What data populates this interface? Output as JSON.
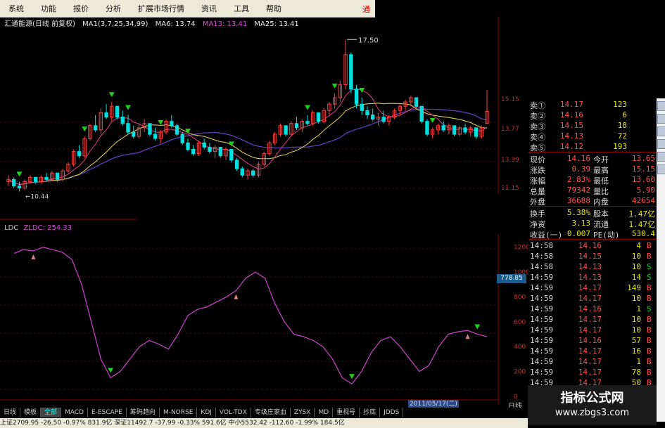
{
  "menu": {
    "items": [
      "系统",
      "功能",
      "报价",
      "分析",
      "扩展市场行情",
      "资讯",
      "工具",
      "帮助"
    ],
    "corner_label": "通"
  },
  "title": {
    "stock": "汇通能源(日线 前复权)",
    "ma1": "MA1(3,7,25,34,99)",
    "ma6": "MA6: 13.74",
    "ma13": "MA13: 13.41",
    "ma25": "MA25: 13.41"
  },
  "annotations": {
    "high": "17.50",
    "low": "10.44"
  },
  "left_axis_ticks": [
    "1200",
    "1000",
    "800",
    "600",
    "400",
    "200",
    "0"
  ],
  "ldc": {
    "label": "LDC",
    "value": "ZLDC: 254.33"
  },
  "price_tag": "778.85",
  "right_axis_main": [
    "15.15",
    "13.77",
    "13.39",
    "11.15"
  ],
  "quote_panel": {
    "asks": [
      {
        "label": "卖①",
        "price": "14.17",
        "vol": "123"
      },
      {
        "label": "卖②",
        "price": "14.16",
        "vol": "6"
      },
      {
        "label": "卖③",
        "price": "14.15",
        "vol": "18"
      },
      {
        "label": "卖④",
        "price": "14.13",
        "vol": "72"
      },
      {
        "label": "卖⑤",
        "price": "14.12",
        "vol": "193"
      }
    ],
    "stats": [
      {
        "l1": "现价",
        "v1": "14.16",
        "l2": "今开",
        "v2": "13.65"
      },
      {
        "l1": "涨跌",
        "v1": "0.39",
        "l2": "最高",
        "v2": "15.15"
      },
      {
        "l1": "涨幅",
        "v1": "2.83%",
        "l2": "最低",
        "v2": "13.60"
      },
      {
        "l1": "总量",
        "v1": "79342",
        "l2": "量比",
        "v2": "5.90"
      },
      {
        "l1": "外盘",
        "v1": "36688",
        "l2": "内盘",
        "v2": "42654"
      }
    ],
    "stats2": [
      {
        "l1": "换手",
        "v1": "5.38%",
        "l2": "股本",
        "v2": "1.47亿"
      },
      {
        "l1": "净资",
        "v1": "3.13",
        "l2": "流通",
        "v2": "1.47亿"
      },
      {
        "l1": "收益(一)",
        "v1": "0.007",
        "l2": "PE(动)",
        "v2": "530.4"
      }
    ],
    "ticks": [
      {
        "t": "14:58",
        "p": "14.16",
        "v": "4",
        "s": "B"
      },
      {
        "t": "14:58",
        "p": "14.15",
        "v": "10",
        "s": "B"
      },
      {
        "t": "14:58",
        "p": "14.13",
        "v": "10",
        "s": "S"
      },
      {
        "t": "14:59",
        "p": "14.13",
        "v": "14",
        "s": "S"
      },
      {
        "t": "14:59",
        "p": "14.17",
        "v": "149",
        "s": "B"
      },
      {
        "t": "14:59",
        "p": "14.17",
        "v": "10",
        "s": "B"
      },
      {
        "t": "14:59",
        "p": "14.16",
        "v": "1",
        "s": "S"
      },
      {
        "t": "14:59",
        "p": "14.17",
        "v": "10",
        "s": "B"
      },
      {
        "t": "14:59",
        "p": "14.17",
        "v": "10",
        "s": "B"
      },
      {
        "t": "14:59",
        "p": "14.16",
        "v": "57",
        "s": "B"
      },
      {
        "t": "14:59",
        "p": "14.17",
        "v": "16",
        "s": "B"
      },
      {
        "t": "14:59",
        "p": "14.17",
        "v": "1",
        "s": "B"
      },
      {
        "t": "14:59",
        "p": "14.17",
        "v": "78",
        "s": "B"
      },
      {
        "t": "14:59",
        "p": "14.17",
        "v": "50",
        "s": "B"
      }
    ]
  },
  "tabs": [
    "日线",
    "模板",
    "全部",
    "MACD",
    "E-ESCAPE",
    "筹码趋向",
    "M-NORSE",
    "KDJ",
    "VOL-TDX",
    "专级庄家血",
    "ZYSX",
    "MD",
    "重视号",
    "抄底",
    "JDDS"
  ],
  "active_tab_index": 2,
  "date_box": "2011/05/17(二)",
  "daily_label": "日线",
  "status_text": "上证2709.95 -26.50 -0.97% 831.9亿 深证11492.7 -37.99 -0.33% 591.6亿 中小5532.42 -112.60 -1.99% 184.5亿",
  "watermark": {
    "line1": "指标公式网",
    "line2": "www.zbgs3.com"
  },
  "colors": {
    "up": "#ff3c3c",
    "down": "#00e0e0",
    "ldc": "#c040c0",
    "ma_yellow": "#d8c850",
    "ma_purple": "#6040c0",
    "ma_pink": "#e04080"
  },
  "chart_data": {
    "type": "candlestick",
    "candles": [
      [
        10.9,
        11.2,
        10.7,
        11.0
      ],
      [
        11.0,
        11.1,
        10.6,
        10.7
      ],
      [
        10.7,
        10.9,
        10.44,
        10.6
      ],
      [
        10.6,
        11.0,
        10.5,
        10.9
      ],
      [
        10.9,
        11.2,
        10.8,
        11.1
      ],
      [
        11.1,
        11.0,
        10.8,
        10.9
      ],
      [
        10.9,
        11.2,
        10.8,
        11.1
      ],
      [
        11.1,
        11.3,
        10.9,
        11.0
      ],
      [
        11.0,
        11.4,
        10.9,
        11.3
      ],
      [
        11.3,
        11.2,
        10.9,
        11.0
      ],
      [
        11.0,
        11.5,
        10.9,
        11.4
      ],
      [
        11.4,
        11.8,
        11.3,
        11.7
      ],
      [
        11.7,
        12.4,
        11.6,
        12.3
      ],
      [
        12.3,
        12.6,
        12.0,
        12.1
      ],
      [
        12.1,
        13.0,
        12.0,
        12.9
      ],
      [
        12.9,
        13.6,
        12.8,
        13.5
      ],
      [
        13.5,
        14.0,
        13.2,
        13.3
      ],
      [
        13.3,
        14.3,
        13.1,
        14.1
      ],
      [
        14.1,
        14.5,
        13.8,
        13.9
      ],
      [
        13.9,
        14.6,
        13.7,
        14.4
      ],
      [
        14.4,
        14.3,
        13.8,
        13.9
      ],
      [
        13.9,
        14.2,
        13.5,
        13.6
      ],
      [
        13.6,
        14.0,
        13.1,
        13.2
      ],
      [
        13.2,
        13.5,
        12.9,
        13.0
      ],
      [
        13.0,
        13.6,
        12.9,
        13.4
      ],
      [
        13.4,
        13.8,
        13.2,
        13.6
      ],
      [
        13.6,
        13.5,
        13.0,
        13.1
      ],
      [
        13.1,
        13.4,
        12.8,
        12.9
      ],
      [
        12.9,
        13.3,
        12.7,
        13.2
      ],
      [
        13.2,
        13.8,
        13.1,
        13.7
      ],
      [
        13.7,
        14.0,
        13.4,
        13.5
      ],
      [
        13.5,
        13.6,
        13.0,
        13.1
      ],
      [
        13.1,
        13.2,
        12.6,
        12.7
      ],
      [
        12.7,
        12.9,
        12.3,
        12.4
      ],
      [
        12.4,
        12.6,
        12.1,
        12.2
      ],
      [
        12.2,
        12.8,
        12.1,
        12.7
      ],
      [
        12.7,
        12.9,
        12.4,
        12.5
      ],
      [
        12.5,
        12.7,
        12.2,
        12.3
      ],
      [
        12.3,
        12.6,
        12.0,
        12.5
      ],
      [
        12.5,
        12.4,
        12.0,
        12.1
      ],
      [
        12.1,
        12.5,
        11.9,
        12.4
      ],
      [
        12.4,
        12.3,
        11.8,
        11.9
      ],
      [
        11.9,
        12.0,
        11.4,
        11.5
      ],
      [
        11.5,
        11.6,
        11.1,
        11.2
      ],
      [
        11.2,
        11.5,
        11.0,
        11.4
      ],
      [
        11.4,
        11.5,
        11.1,
        11.2
      ],
      [
        11.2,
        11.8,
        11.1,
        11.7
      ],
      [
        11.7,
        12.3,
        11.6,
        12.2
      ],
      [
        12.2,
        12.8,
        12.1,
        12.7
      ],
      [
        12.7,
        13.2,
        12.6,
        13.1
      ],
      [
        13.1,
        13.6,
        13.0,
        13.5
      ],
      [
        13.5,
        13.4,
        13.0,
        13.1
      ],
      [
        13.1,
        13.7,
        13.0,
        13.6
      ],
      [
        13.6,
        13.9,
        13.3,
        13.4
      ],
      [
        13.4,
        13.8,
        13.2,
        13.7
      ],
      [
        13.7,
        14.0,
        13.5,
        13.6
      ],
      [
        13.6,
        14.2,
        13.5,
        14.1
      ],
      [
        14.1,
        14.0,
        13.6,
        13.7
      ],
      [
        13.7,
        14.3,
        13.6,
        14.2
      ],
      [
        14.2,
        14.6,
        14.0,
        14.5
      ],
      [
        14.5,
        15.0,
        14.3,
        14.8
      ],
      [
        14.8,
        15.6,
        14.6,
        15.4
      ],
      [
        15.4,
        17.5,
        15.2,
        16.8
      ],
      [
        16.8,
        16.9,
        15.0,
        15.2
      ],
      [
        15.2,
        15.4,
        14.3,
        14.5
      ],
      [
        14.5,
        14.8,
        14.0,
        14.2
      ],
      [
        14.2,
        14.4,
        13.8,
        14.0
      ],
      [
        14.0,
        14.3,
        13.7,
        13.8
      ],
      [
        13.8,
        14.1,
        13.5,
        13.9
      ],
      [
        13.9,
        14.2,
        13.6,
        13.7
      ],
      [
        13.7,
        14.0,
        13.5,
        13.9
      ],
      [
        13.9,
        14.3,
        13.8,
        14.2
      ],
      [
        14.2,
        14.5,
        14.0,
        14.4
      ],
      [
        14.4,
        14.7,
        14.2,
        14.6
      ],
      [
        14.6,
        14.9,
        14.4,
        14.8
      ],
      [
        14.8,
        14.7,
        14.3,
        14.4
      ],
      [
        14.4,
        14.3,
        13.6,
        13.7
      ],
      [
        13.7,
        13.8,
        13.0,
        13.1
      ],
      [
        13.1,
        13.4,
        12.9,
        13.3
      ],
      [
        13.3,
        13.6,
        13.1,
        13.5
      ],
      [
        13.5,
        13.7,
        13.2,
        13.3
      ],
      [
        13.3,
        13.6,
        13.1,
        13.5
      ],
      [
        13.5,
        13.4,
        13.0,
        13.1
      ],
      [
        13.1,
        13.5,
        13.0,
        13.4
      ],
      [
        13.4,
        13.6,
        13.1,
        13.2
      ],
      [
        13.2,
        13.5,
        13.0,
        13.4
      ],
      [
        13.4,
        13.3,
        12.9,
        13.0
      ],
      [
        13.0,
        13.5,
        12.9,
        13.4
      ],
      [
        13.6,
        15.15,
        13.6,
        14.16
      ]
    ],
    "ldc_values": [
      1150,
      1180,
      1170,
      1200,
      1180,
      1160,
      1100,
      900,
      600,
      300,
      150,
      200,
      300,
      400,
      450,
      420,
      380,
      500,
      650,
      700,
      720,
      760,
      800,
      850,
      950,
      1000,
      950,
      750,
      600,
      500,
      480,
      450,
      400,
      300,
      150,
      100,
      200,
      350,
      450,
      480,
      400,
      300,
      200,
      250,
      400,
      500,
      520,
      530,
      500,
      480
    ]
  }
}
